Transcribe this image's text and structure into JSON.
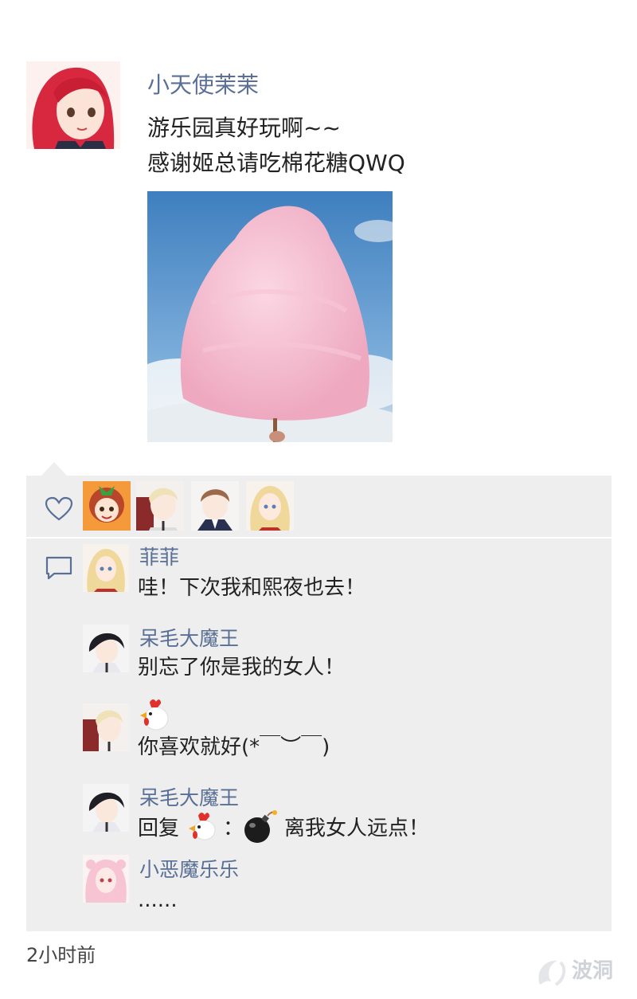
{
  "post": {
    "author": "小天使茉茉",
    "text_line1": "游乐园真好玩啊~~",
    "text_line2": "感谢姬总请吃棉花糖QWQ",
    "image_label": "cotton-candy-photo",
    "time": "2小时前"
  },
  "likes": {
    "icon": "heart-icon",
    "avatars": [
      "avatar-orange-hair-girl",
      "avatar-blond-boy",
      "avatar-brown-hair-boy",
      "avatar-blonde-girl"
    ]
  },
  "comments": [
    {
      "name": "菲菲",
      "text": "哇！下次我和熙夜也去！"
    },
    {
      "name": "呆毛大魔王",
      "text": "别忘了你是我的女人！"
    },
    {
      "name": "",
      "name_icon": "chicken-emoji",
      "text": "你喜欢就好(*￣︶￣)"
    },
    {
      "name": "呆毛大魔王",
      "reply_prefix": "回复",
      "reply_colon": "：",
      "reply_target_icon": "chicken-emoji",
      "bomb_icon": "bomb-emoji",
      "text": "离我女人远点！"
    },
    {
      "name": "小恶魔乐乐",
      "text": "......"
    }
  ],
  "watermark": {
    "text": "波洞",
    "icon": "bodong-logo"
  },
  "colors": {
    "name_blue": "#5a6f95",
    "panel_bg": "#eeeeee",
    "sky": "#4a8ac4",
    "candy_pink": "#f2b8cc"
  }
}
